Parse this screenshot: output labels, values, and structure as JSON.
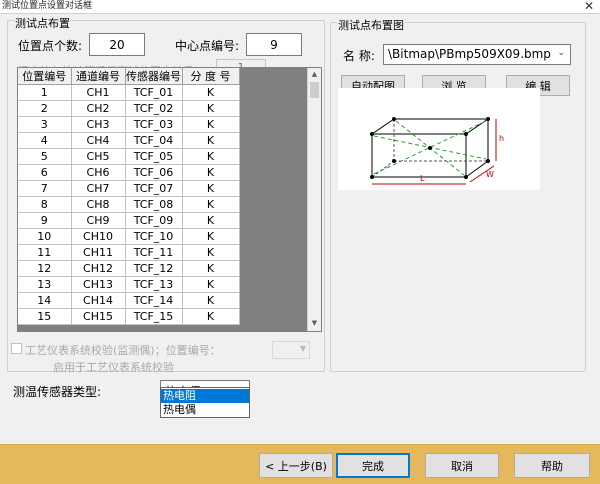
{
  "window": {
    "title": "测试位置点设置对话框",
    "close_glyph": "✕"
  },
  "left_group": {
    "label": "测试点布置",
    "count_label": "位置点个数:",
    "count_value": "20",
    "center_label": "中心点编号:",
    "center_value": "9",
    "temp_calc_label": "温度均匀性计算采用测试位置点编号",
    "temp_calc_value": "1",
    "columns": [
      "位置编号",
      "通道编号",
      "传感器编号",
      "分 度 号"
    ],
    "rows": [
      [
        "1",
        "CH1",
        "TCF_01",
        "K"
      ],
      [
        "2",
        "CH2",
        "TCF_02",
        "K"
      ],
      [
        "3",
        "CH3",
        "TCF_03",
        "K"
      ],
      [
        "4",
        "CH4",
        "TCF_04",
        "K"
      ],
      [
        "5",
        "CH5",
        "TCF_05",
        "K"
      ],
      [
        "6",
        "CH6",
        "TCF_06",
        "K"
      ],
      [
        "7",
        "CH7",
        "TCF_07",
        "K"
      ],
      [
        "8",
        "CH8",
        "TCF_08",
        "K"
      ],
      [
        "9",
        "CH9",
        "TCF_09",
        "K"
      ],
      [
        "10",
        "CH10",
        "TCF_10",
        "K"
      ],
      [
        "11",
        "CH11",
        "TCF_11",
        "K"
      ],
      [
        "12",
        "CH12",
        "TCF_12",
        "K"
      ],
      [
        "13",
        "CH13",
        "TCF_13",
        "K"
      ],
      [
        "14",
        "CH14",
        "TCF_14",
        "K"
      ],
      [
        "15",
        "CH15",
        "TCF_15",
        "K"
      ]
    ],
    "scroll_up": "▲",
    "scroll_down": "▼",
    "verify_label": "工艺仪表系统校验(监测偶)；位置编号：",
    "enable_label": "启用于工艺仪表系统校验"
  },
  "sensor_type": {
    "label": "测温传感器类型:",
    "selected": "热电偶",
    "options": [
      "热电阻",
      "热电偶"
    ],
    "highlighted_index": 0
  },
  "right_group": {
    "label": "测试点布置图",
    "name_label": "名  称:",
    "file_value": "\\Bitmap\\PBmp509X09.bmp",
    "buttons": {
      "auto": "自动配图",
      "browse": "浏  览",
      "edit": "编  辑"
    },
    "diagram_labels": [
      "L",
      "h",
      "W"
    ]
  },
  "footer": {
    "prev": "< 上一步(B)",
    "finish": "完成",
    "cancel": "取消",
    "help": "帮助"
  },
  "colors": {
    "footer": "#e6b85c",
    "selection": "#0078d7",
    "focus_border": "#0078d7"
  },
  "icons": {
    "dropdown": "chevron-down-icon",
    "close": "close-icon"
  }
}
